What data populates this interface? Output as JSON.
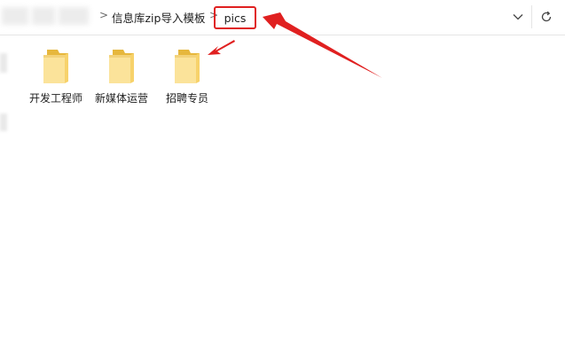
{
  "address_bar": {
    "breadcrumb_parent": "信息库zip导入模板",
    "separator": ">",
    "current_folder": "pics",
    "dropdown_icon": "chevron-down-icon",
    "refresh_icon": "refresh-icon"
  },
  "folders": [
    {
      "label": "开发工程师",
      "icon": "folder-icon"
    },
    {
      "label": "新媒体运营",
      "icon": "folder-icon"
    },
    {
      "label": "招聘专员",
      "icon": "folder-icon"
    }
  ],
  "colors": {
    "annotation_red": "#e02020",
    "folder_yellow": "#f7d26b",
    "folder_light": "#fbe39a"
  }
}
